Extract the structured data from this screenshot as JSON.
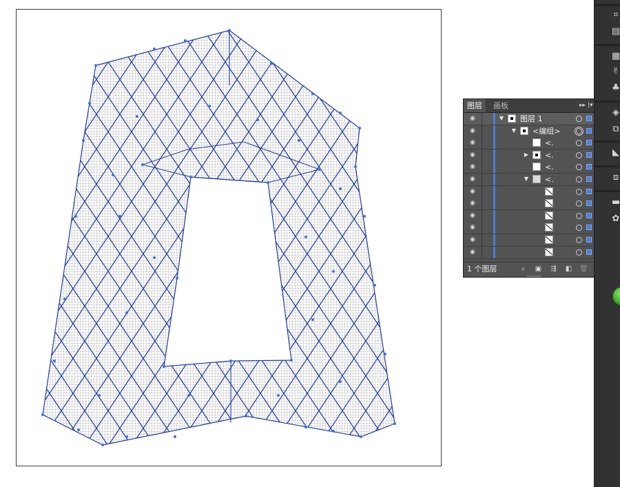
{
  "canvas": {
    "artwork": "mesh-building-artwork",
    "grid_color": "#555555",
    "path_color": "#1d3aa0",
    "anchor_color": "#3e6fe0"
  },
  "layers_panel": {
    "tabs": [
      {
        "label": "图层"
      },
      {
        "label": "画板"
      }
    ],
    "collapse_label": "▸▸",
    "menu_label": "|▾≡",
    "layer_rows": [
      {
        "name": "图层 1",
        "expanded": true,
        "thumb": "dot"
      },
      {
        "name": "<编组>",
        "expanded": true,
        "thumb": "dot"
      },
      {
        "name": "<.",
        "thumb": "blank"
      },
      {
        "name": "<.",
        "expanded": false,
        "thumb": "dot"
      },
      {
        "name": "<.",
        "thumb": "blank"
      },
      {
        "name": "<.",
        "expanded": true,
        "thumb": "figure"
      },
      {
        "name": "",
        "thumb": "slash"
      },
      {
        "name": "",
        "thumb": "slash"
      },
      {
        "name": "",
        "thumb": "slash"
      },
      {
        "name": "",
        "thumb": "slash"
      },
      {
        "name": "",
        "thumb": "slash"
      },
      {
        "name": "",
        "thumb": "slash"
      }
    ],
    "footer": {
      "layer_count": "1 个图层",
      "icons": [
        "locate-object-icon",
        "make-clipping-mask-icon",
        "create-sublayer-icon",
        "new-layer-icon",
        "delete-layer-icon"
      ]
    },
    "accent_color": "#4a7fd9"
  },
  "tool_strip": {
    "icons": [
      "grid-icon",
      "align-icon",
      "table-icon",
      "puppet-icon",
      "club-icon",
      "layers-icon",
      "artboard-icon",
      "gradient-icon",
      "stack-icon",
      "transparency-icon",
      "appearance-icon"
    ]
  }
}
